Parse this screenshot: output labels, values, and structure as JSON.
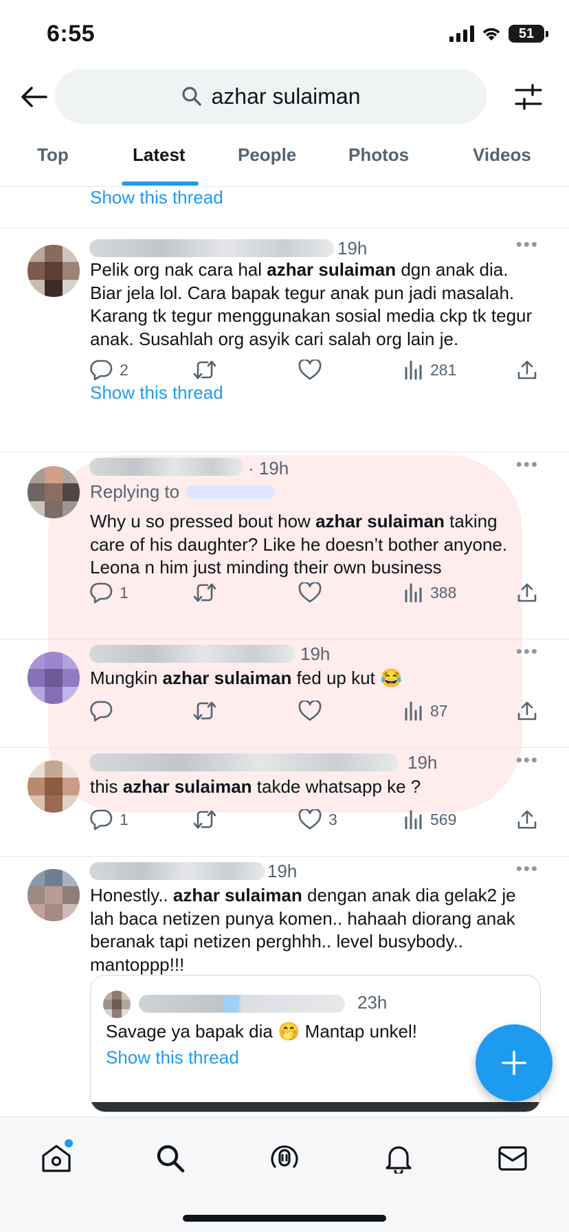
{
  "status": {
    "time": "6:55",
    "battery": "51"
  },
  "search": {
    "query": "azhar sulaiman"
  },
  "tabs": [
    {
      "label": "Top"
    },
    {
      "label": "Latest"
    },
    {
      "label": "People"
    },
    {
      "label": "Photos"
    },
    {
      "label": "Videos"
    }
  ],
  "feed": {
    "top_show_thread": "Show this thread",
    "tweets": [
      {
        "time": "19h",
        "segments": [
          "Pelik org nak cara hal ",
          "azhar sulaiman",
          " dgn anak dia. Biar jela lol. Cara bapak tegur anak pun jadi masalah. Karang tk tegur menggunakan sosial media ckp tk tegur anak. Susahlah org asyik cari salah org lain je."
        ],
        "replies": "2",
        "retweets": "",
        "likes": "",
        "views": "281",
        "show_thread": "Show this thread"
      },
      {
        "time": "· 19h",
        "replying_to": "Replying to",
        "segments": [
          "Why u so pressed bout how ",
          "azhar sulaiman",
          " taking care of his daughter? Like he doesn’t bother anyone. Leona n him just minding their own business"
        ],
        "replies": "1",
        "retweets": "",
        "likes": "",
        "views": "388"
      },
      {
        "time": "19h",
        "segments": [
          "Mungkin ",
          "azhar sulaiman",
          " fed up kut 😂"
        ],
        "replies": "",
        "retweets": "",
        "likes": "",
        "views": "87"
      },
      {
        "time": "19h",
        "segments": [
          "this ",
          "azhar sulaiman",
          " takde whatsapp ke ?"
        ],
        "replies": "1",
        "retweets": "",
        "likes": "3",
        "views": "569"
      },
      {
        "time": "19h",
        "segments": [
          "Honestly.. ",
          "azhar sulaiman",
          " dengan anak dia gelak2 je lah baca netizen punya komen.. hahaah diorang anak beranak tapi netizen perghhh.. level busybody.. mantoppp!!!"
        ],
        "quote": {
          "time": "23h",
          "text": "Savage ya bapak dia 🤭 Mantap unkel!",
          "show_thread": "Show this thread"
        }
      }
    ]
  },
  "colors": {
    "accent": "#1d9bf0",
    "text": "#0f1419",
    "muted": "#536471"
  },
  "icons": {
    "back": "arrow-left-icon",
    "search": "search-icon",
    "filter": "sliders-icon",
    "reply": "reply-icon",
    "retweet": "retweet-icon",
    "like": "heart-icon",
    "views": "bar-chart-icon",
    "share": "share-icon",
    "more": "more-icon",
    "compose": "plus-icon",
    "home": "home-icon",
    "explore": "search-icon",
    "spaces": "spaces-icon",
    "notifications": "bell-icon",
    "messages": "mail-icon"
  }
}
